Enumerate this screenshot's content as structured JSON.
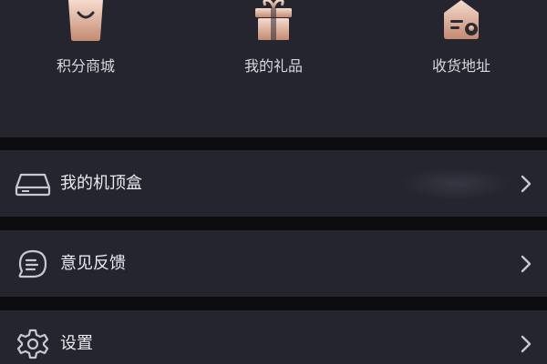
{
  "colors": {
    "panel_bg": "#25252f",
    "divider_bg": "#0d0d10",
    "icon_gradient_light": "#f3d2bf",
    "icon_gradient_dark": "#c9927a",
    "text_primary": "#ececf0",
    "text_secondary": "#d8d8de"
  },
  "quick_actions": [
    {
      "label": "积分商城",
      "icon": "shopping-bag-icon"
    },
    {
      "label": "我的礼品",
      "icon": "gift-box-icon"
    },
    {
      "label": "收货地址",
      "icon": "address-house-icon"
    }
  ],
  "menu": [
    {
      "label": "我的机顶盒",
      "icon": "set-top-box-icon"
    },
    {
      "label": "意见反馈",
      "icon": "feedback-bubble-icon"
    },
    {
      "label": "设置",
      "icon": "settings-gear-icon"
    }
  ]
}
